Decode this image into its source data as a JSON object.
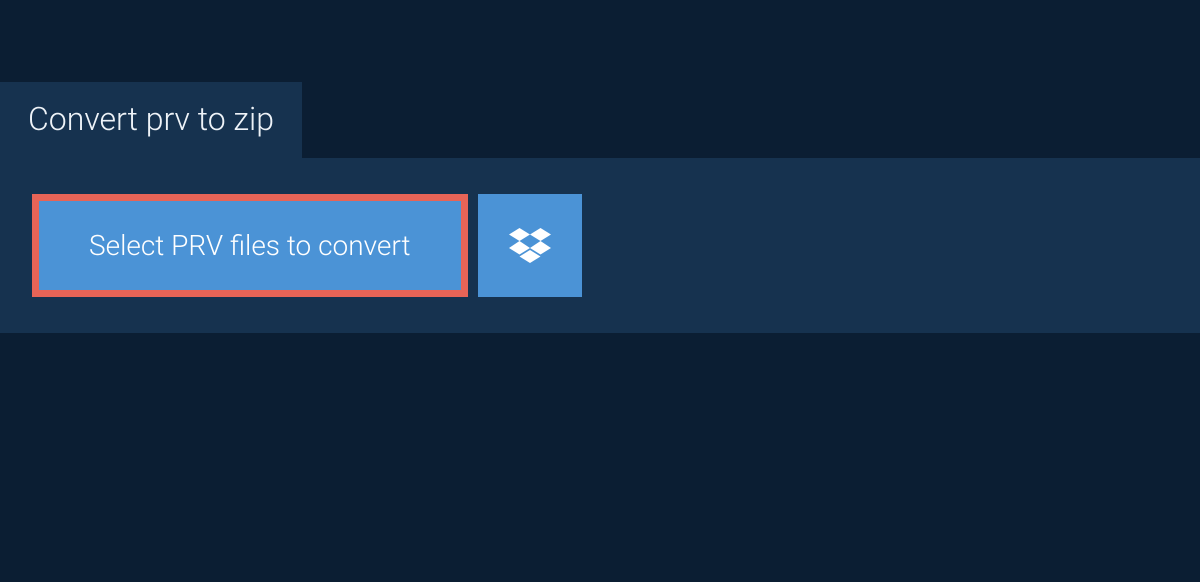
{
  "tab": {
    "label": "Convert prv to zip"
  },
  "actions": {
    "select_files_label": "Select PRV files to convert"
  }
}
